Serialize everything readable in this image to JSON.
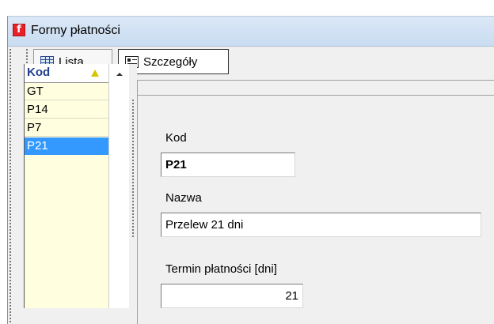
{
  "window": {
    "title": "Formy płatności",
    "icon": "app-red-icon",
    "icon_glyph": "f"
  },
  "tabs": [
    {
      "label": "Lista",
      "icon": "grid-icon",
      "active": false
    },
    {
      "label": "Szczegóły",
      "icon": "form-icon",
      "active": true
    }
  ],
  "list": {
    "header": "Kod",
    "rows": [
      "GT",
      "P14",
      "P7",
      "P21"
    ],
    "selected_index": 3
  },
  "details": {
    "kod_label": "Kod",
    "kod_value": "P21",
    "nazwa_label": "Nazwa",
    "nazwa_value": "Przelew 21 dni",
    "termin_label": "Termin płatności [dni]",
    "termin_value": "21"
  },
  "colors": {
    "selection": "#3399ff",
    "list_background": "#ffffe0",
    "header_text": "#1f3e8f",
    "app_icon": "#e8202a"
  }
}
